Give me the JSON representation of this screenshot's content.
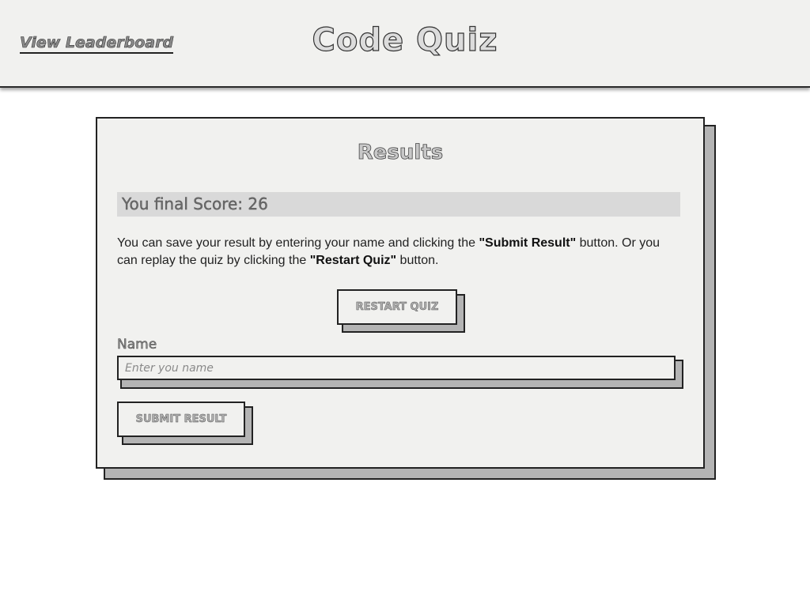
{
  "header": {
    "leaderboard_link": "View Leaderboard",
    "app_title": "Code Quiz"
  },
  "results": {
    "title": "Results",
    "score_label": "You final Score: 26",
    "instructions_part1": "You can save your result by entering your name and clicking the ",
    "instructions_bold1": "\"Submit Result\"",
    "instructions_part2": " button. Or you can replay the quiz by clicking the ",
    "instructions_bold2": "\"Restart Quiz\"",
    "instructions_part3": " button.",
    "restart_button": "RESTART QUIZ",
    "name_label": "Name",
    "name_placeholder": "Enter you name",
    "name_value": "",
    "submit_button": "SUBMIT RESULT"
  },
  "colors": {
    "background": "#ffffff",
    "panel": "#f1f1ef",
    "shadow": "#b4b4b4",
    "score_bar": "#d9d9d9",
    "border": "#222222"
  }
}
